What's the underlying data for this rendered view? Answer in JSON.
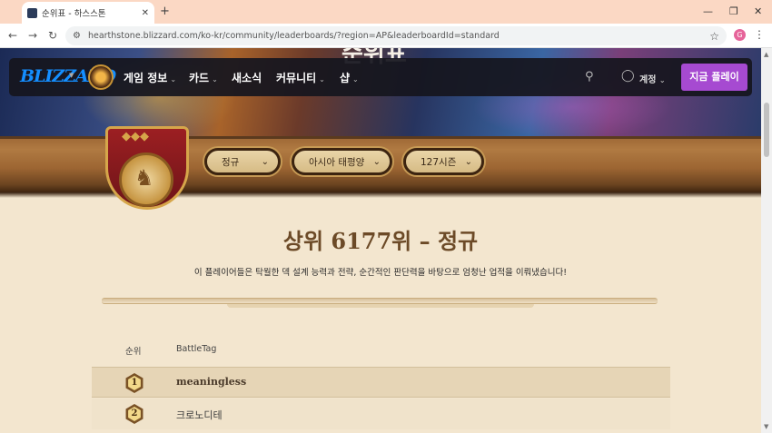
{
  "browser": {
    "tab_title": "순위표 - 하스스톤",
    "tab_close": "✕",
    "new_tab": "+",
    "url": "hearthstone.blizzard.com/ko-kr/community/leaderboards/?region=AP&leaderboardId=standard",
    "profile_initial": "G",
    "win_min": "—",
    "win_max": "❐",
    "win_close": "✕"
  },
  "hero": {
    "title_partial": "순위표"
  },
  "navbar": {
    "logo": "BLIZZARD",
    "links": [
      "게임 정보",
      "카드",
      "새소식",
      "커뮤니티",
      "샵"
    ],
    "account_label": "계정",
    "play_button": "지금 플레이"
  },
  "filters": {
    "mode": "정규",
    "region": "아시아 태평양",
    "season": "127시즌"
  },
  "heading": {
    "title": "상위 6177위 – 정규",
    "description": "이 플레이어들은 탁월한 덱 설계 능력과 전략, 순간적인 판단력을 바탕으로 엄청난 업적을 이뤄냈습니다!"
  },
  "table": {
    "columns": [
      "순위",
      "BattleTag"
    ],
    "rows": [
      {
        "rank": "1",
        "battletag": "meaningless"
      },
      {
        "rank": "2",
        "battletag": "크로노디테"
      }
    ]
  },
  "colors": {
    "accent_purple": "#a64ad1",
    "title_brown": "#6c4a27",
    "blizzard_blue": "#148eff"
  }
}
